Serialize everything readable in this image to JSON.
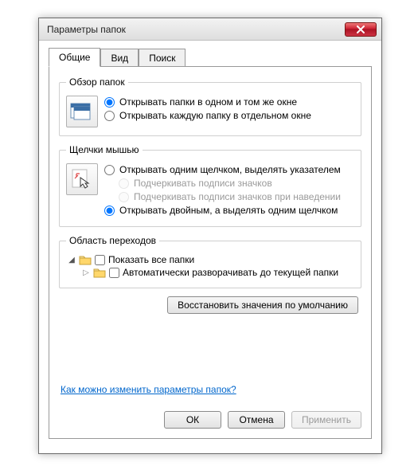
{
  "window": {
    "title": "Параметры папок"
  },
  "tabs": {
    "general": "Общие",
    "view": "Вид",
    "search": "Поиск"
  },
  "browse": {
    "legend": "Обзор папок",
    "same_window": "Открывать папки в одном и том же окне",
    "new_window": "Открывать каждую папку в отдельном окне"
  },
  "click": {
    "legend": "Щелчки мышью",
    "single": "Открывать одним щелчком, выделять указателем",
    "underline_always": "Подчеркивать подписи значков",
    "underline_hover": "Подчеркивать подписи значков при наведении",
    "double": "Открывать двойным, а выделять одним щелчком"
  },
  "nav": {
    "legend": "Область переходов",
    "show_all": "Показать все папки",
    "auto_expand": "Автоматически разворачивать до текущей папки"
  },
  "restore": "Восстановить значения по умолчанию",
  "help_link": "Как можно изменить параметры папок?",
  "buttons": {
    "ok": "ОК",
    "cancel": "Отмена",
    "apply": "Применить"
  }
}
